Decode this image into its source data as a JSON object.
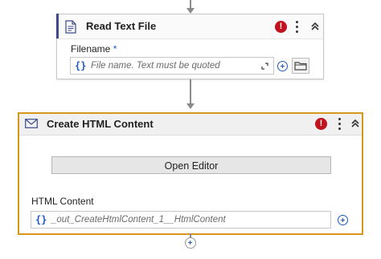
{
  "read_text_file": {
    "title": "Read Text File",
    "error_badge": "!",
    "icon": "document-icon",
    "filename": {
      "label": "Filename",
      "required_marker": "*",
      "brace": "{}",
      "placeholder": "File name. Text must be quoted"
    }
  },
  "create_html_content": {
    "title": "Create HTML Content",
    "error_badge": "!",
    "icon": "mail-icon",
    "open_editor_label": "Open Editor",
    "html_content": {
      "label": "HTML Content",
      "brace": "{}",
      "value": "_out_CreateHtmlContent_1__HtmlContent"
    }
  },
  "colors": {
    "selection_border": "#d6971a",
    "error": "#c1121f",
    "accent_blue": "#1a59c6",
    "connector": "#8a8a8a"
  }
}
